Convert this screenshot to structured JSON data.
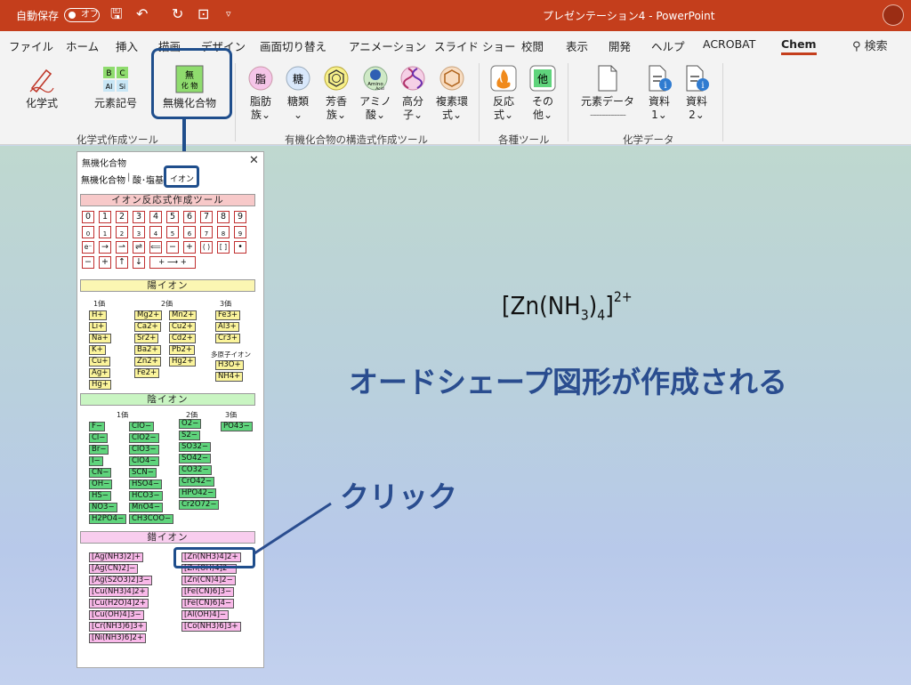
{
  "titlebar": {
    "autosave_label": "自動保存",
    "autosave_state": "オフ",
    "title": "プレゼンテーション4 - PowerPoint"
  },
  "menu_tabs": [
    "ファイル",
    "ホーム",
    "挿入",
    "描画",
    "デザイン",
    "画面切り替え",
    "アニメーション",
    "スライド ショー",
    "校閲",
    "表示",
    "開発",
    "ヘルプ",
    "ACROBAT",
    "Chem"
  ],
  "active_tab": "Chem",
  "search_label": "検索",
  "ribbon": {
    "buttons": {
      "chem_formula": "化学式",
      "element_symbol": "元素記号",
      "inorganic": "無機化合物",
      "fat1": "脂肪",
      "fat2": "族",
      "sugar1": "糖類",
      "arom1": "芳香",
      "arom2": "族",
      "amino1": "アミノ",
      "amino2": "酸",
      "poly1": "高分",
      "poly2": "子",
      "hetero1": "複素環",
      "hetero2": "式",
      "react1": "反応",
      "react2": "式",
      "other1": "その",
      "other2": "他",
      "elem_data": "元素データ",
      "doc1_1": "資料",
      "doc1_2": "1",
      "doc2_1": "資料",
      "doc2_2": "2"
    },
    "icon_text": {
      "fat": "脂",
      "sugar": "糖",
      "other": "他",
      "el_b": "B",
      "el_c": "C",
      "el_al": "Al",
      "el_si": "Si",
      "inorg_top": "無",
      "inorg_bot": "化 物",
      "amino_a": "Amino",
      "amino_b": "Acid"
    },
    "groups": {
      "chem_tools": "化学式作成ツール",
      "organic": "有機化合物の構造式作成ツール",
      "various": "各種ツール",
      "chem_data": "化学データ"
    }
  },
  "panel": {
    "title": "無機化合物",
    "close": "✕",
    "tab_inorganic": "無機化合物",
    "tab_acid_salt": "酸･塩基",
    "tab_ion": "イオン",
    "ion_section": "イオン反応式作成ツール",
    "digits": [
      "0",
      "1",
      "2",
      "3",
      "4",
      "5",
      "6",
      "7",
      "8",
      "9"
    ],
    "sub_digits": [
      "0",
      "1",
      "2",
      "3",
      "4",
      "5",
      "6",
      "7",
      "8",
      "9"
    ],
    "ops_row1": [
      "e⁻",
      "→",
      "⇀",
      "⇌",
      "⟸",
      "−",
      "+",
      "( )",
      "[ ]",
      "•"
    ],
    "ops_row2": [
      "−",
      "+",
      "↑",
      "↓",
      "+ ⟶ +"
    ],
    "cation_section": "陽イオン",
    "cation_heads": [
      "1価",
      "2価",
      "3価"
    ],
    "cations_1": [
      "H+",
      "Li+",
      "Na+",
      "K+",
      "Cu+",
      "Ag+",
      "Hg+"
    ],
    "cations_2a": [
      "Mg2+",
      "Ca2+",
      "Sr2+",
      "Ba2+",
      "Zn2+",
      "Fe2+"
    ],
    "cations_2b": [
      "Mn2+",
      "Cu2+",
      "Cd2+",
      "Pb2+",
      "Hg2+"
    ],
    "cations_3": [
      "Fe3+",
      "Al3+",
      "Cr3+"
    ],
    "polyatomic_label": "多原子イオン",
    "polyatomic": [
      "H3O+",
      "NH4+"
    ],
    "anion_section": "陰イオン",
    "anion_heads": [
      "1価",
      "2価",
      "3価"
    ],
    "anions_1a": [
      "F−",
      "Cl−",
      "Br−",
      "I−",
      "CN−",
      "OH−",
      "HS−",
      "NO3−",
      "H2PO4−"
    ],
    "anions_1b": [
      "ClO−",
      "ClO2−",
      "ClO3−",
      "ClO4−",
      "SCN−",
      "HSO4−",
      "HCO3−",
      "MnO4−",
      "CH3COO−"
    ],
    "anions_2": [
      "O2−",
      "S2−",
      "SO32−",
      "SO42−",
      "CO32−",
      "CrO42−",
      "HPO42−",
      "Cr2O72−"
    ],
    "anions_3": [
      "PO43−"
    ],
    "complex_section": "錯イオン",
    "complex_left": [
      "[Ag(NH3)2]+",
      "[Ag(CN)2]−",
      "[Ag(S2O3)2]3−",
      "[Cu(NH3)4]2+",
      "[Cu(H2O)4]2+",
      "[Cu(OH)4]3−",
      "[Cr(NH3)6]3+",
      "[Ni(NH3)6]2+"
    ],
    "complex_right": [
      "[Zn(NH3)4]2+",
      "[Zn(OH)4]2−",
      "[Zn(CN)4]2−",
      "[Fe(CN)6]3−",
      "[Fe(CN)6]4−",
      "[Al(OH)4]−",
      "[Co(NH3)6]3+"
    ]
  },
  "slide": {
    "formula_base": "[Zn(NH",
    "formula_sub1": "3",
    "formula_mid": ")",
    "formula_sub2": "4",
    "formula_close": "]",
    "formula_sup": "2+",
    "caption_autoshape": "オードシェープ図形が作成される",
    "caption_click": "クリック"
  },
  "colors": {
    "titlebar": "#c43e1c",
    "highlight": "#1f4e8c",
    "caption": "#2a4d8f"
  }
}
